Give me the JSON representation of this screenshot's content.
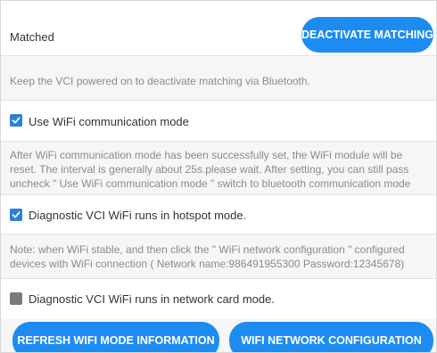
{
  "matching": {
    "status_label": "Matched",
    "deactivate_button": "DEACTIVATE MATCHING",
    "bluetooth_note": "Keep the VCI powered on to deactivate matching via Bluetooth."
  },
  "wifi_mode": {
    "checkbox_label": "Use WiFi communication mode",
    "checked": true,
    "note_line1": "After WiFi communication mode has been successfully set, the WiFi module will be",
    "note_line2": "reset. The interval is generally about 25s.please wait. After setting, you can still pass",
    "note_line3": "uncheck \" Use WiFi communication mode \" switch to bluetooth communication mode"
  },
  "hotspot_mode": {
    "checkbox_label": "Diagnostic VCI WiFi runs in hotspot mode.",
    "checked": true,
    "note_line1": "Note: when WiFi stable, and then click the \" WiFi network configuration \" configured",
    "note_line2": "devices with WiFi connection ( Network name:986491955300  Password:12345678)"
  },
  "network_card_mode": {
    "checkbox_label": "Diagnostic VCI WiFi runs in network card mode.",
    "checked": false
  },
  "footer": {
    "refresh_button": "REFRESH WIFI MODE INFORMATION",
    "config_button": "WIFI NETWORK CONFIGURATION"
  },
  "colors": {
    "accent": "#1d8cf2",
    "checkbox_on": "#2b7fe0",
    "checkbox_off": "#7a7a7a"
  }
}
